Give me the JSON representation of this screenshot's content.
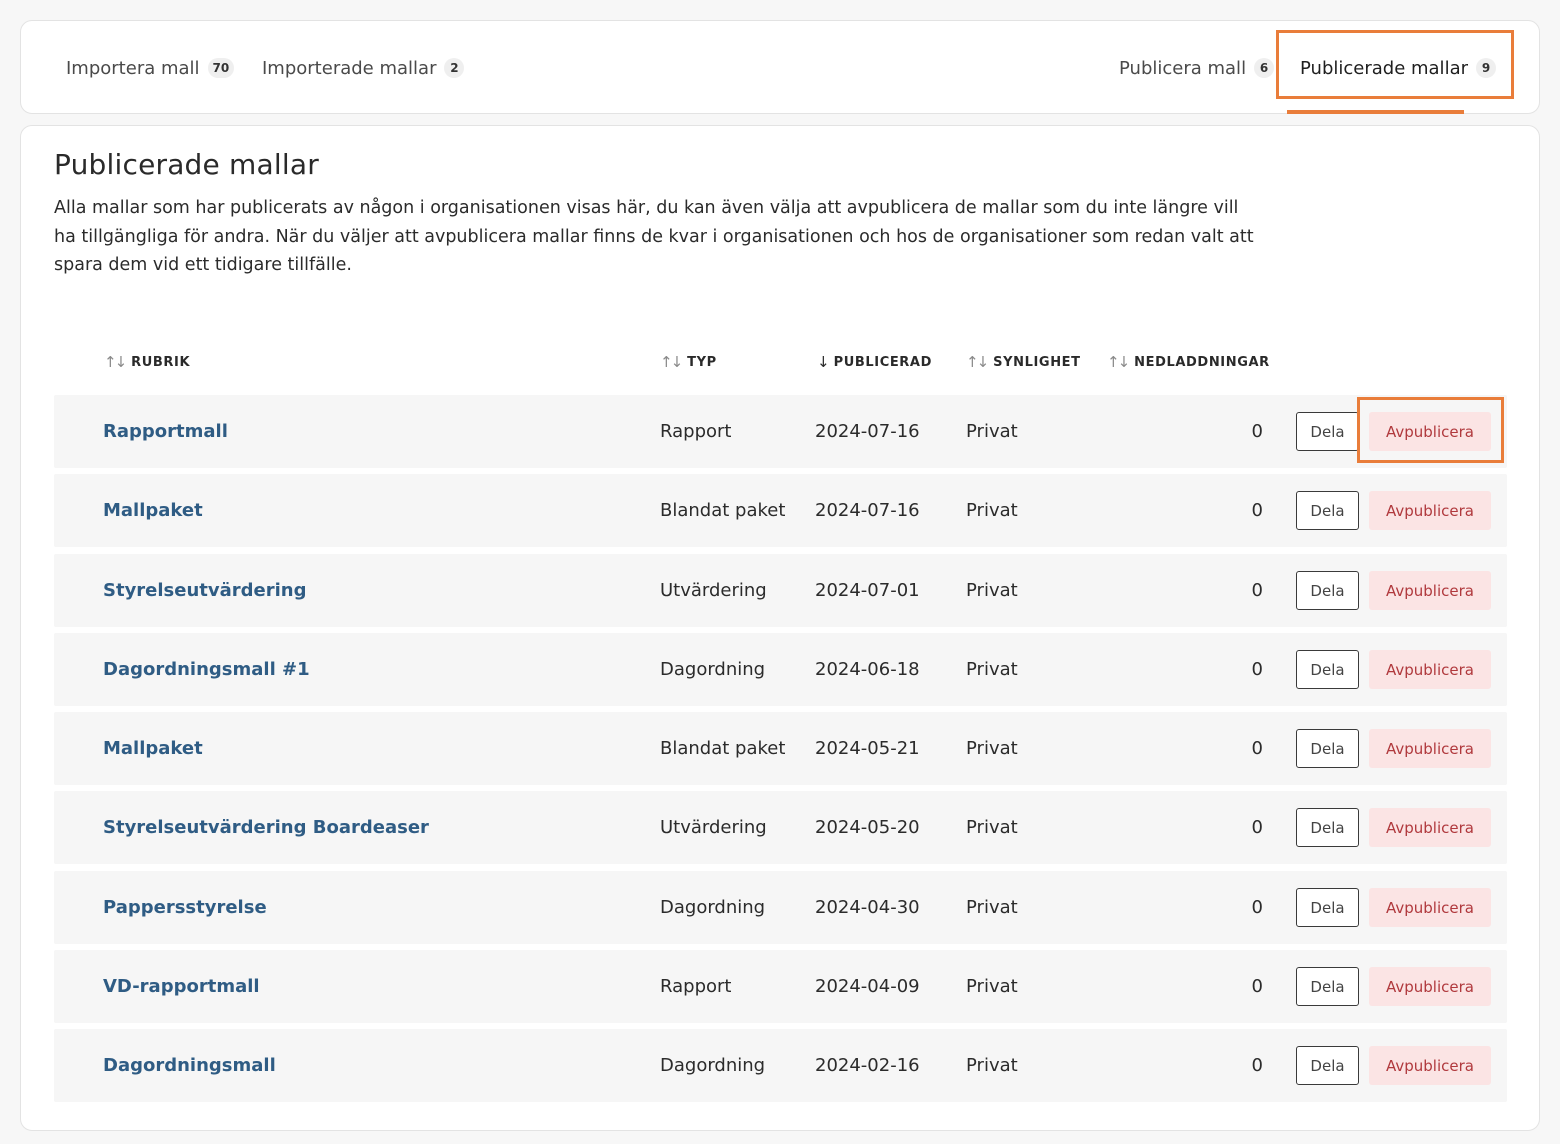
{
  "tabs": [
    {
      "label": "Importera mall",
      "count": "70"
    },
    {
      "label": "Importerade mallar",
      "count": "2"
    },
    {
      "label": "Publicera mall",
      "count": "6"
    },
    {
      "label": "Publicerade mallar",
      "count": "9"
    }
  ],
  "page": {
    "title": "Publicerade mallar",
    "description": "Alla mallar som har publicerats av någon i organisationen visas här, du kan även välja att avpublicera de mallar som du inte längre vill ha tillgängliga för andra. När du väljer att avpublicera mallar finns de kvar i organisationen och hos de organisationer som redan valt att spara dem vid ett tidigare tillfälle."
  },
  "columns": [
    {
      "label": "RUBRIK",
      "sort_icon": "sort-both-icon"
    },
    {
      "label": "TYP",
      "sort_icon": "sort-both-icon"
    },
    {
      "label": "PUBLICERAD",
      "sort_icon": "sort-down-icon"
    },
    {
      "label": "SYNLIGHET",
      "sort_icon": "sort-both-icon"
    },
    {
      "label": "NEDLADDNINGAR",
      "sort_icon": "sort-both-icon"
    }
  ],
  "actions": {
    "share_label": "Dela",
    "unpublish_label": "Avpublicera"
  },
  "rows": [
    {
      "title": "Rapportmall",
      "typ": "Rapport",
      "date": "2024-07-16",
      "visibility": "Privat",
      "downloads": "0"
    },
    {
      "title": "Mallpaket",
      "typ": "Blandat paket",
      "date": "2024-07-16",
      "visibility": "Privat",
      "downloads": "0"
    },
    {
      "title": "Styrelseutvärdering",
      "typ": "Utvärdering",
      "date": "2024-07-01",
      "visibility": "Privat",
      "downloads": "0"
    },
    {
      "title": "Dagordningsmall #1",
      "typ": "Dagordning",
      "date": "2024-06-18",
      "visibility": "Privat",
      "downloads": "0"
    },
    {
      "title": "Mallpaket",
      "typ": "Blandat paket",
      "date": "2024-05-21",
      "visibility": "Privat",
      "downloads": "0"
    },
    {
      "title": "Styrelseutvärdering Boardeaser",
      "typ": "Utvärdering",
      "date": "2024-05-20",
      "visibility": "Privat",
      "downloads": "0"
    },
    {
      "title": "Pappersstyrelse",
      "typ": "Dagordning",
      "date": "2024-04-30",
      "visibility": "Privat",
      "downloads": "0"
    },
    {
      "title": "VD-rapportmall",
      "typ": "Rapport",
      "date": "2024-04-09",
      "visibility": "Privat",
      "downloads": "0"
    },
    {
      "title": "Dagordningsmall",
      "typ": "Dagordning",
      "date": "2024-02-16",
      "visibility": "Privat",
      "downloads": "0"
    }
  ],
  "colors": {
    "accent": "#e97d3a",
    "link": "#2f5c84",
    "danger": "#b0393d",
    "danger_bg": "#fbe4e4"
  }
}
